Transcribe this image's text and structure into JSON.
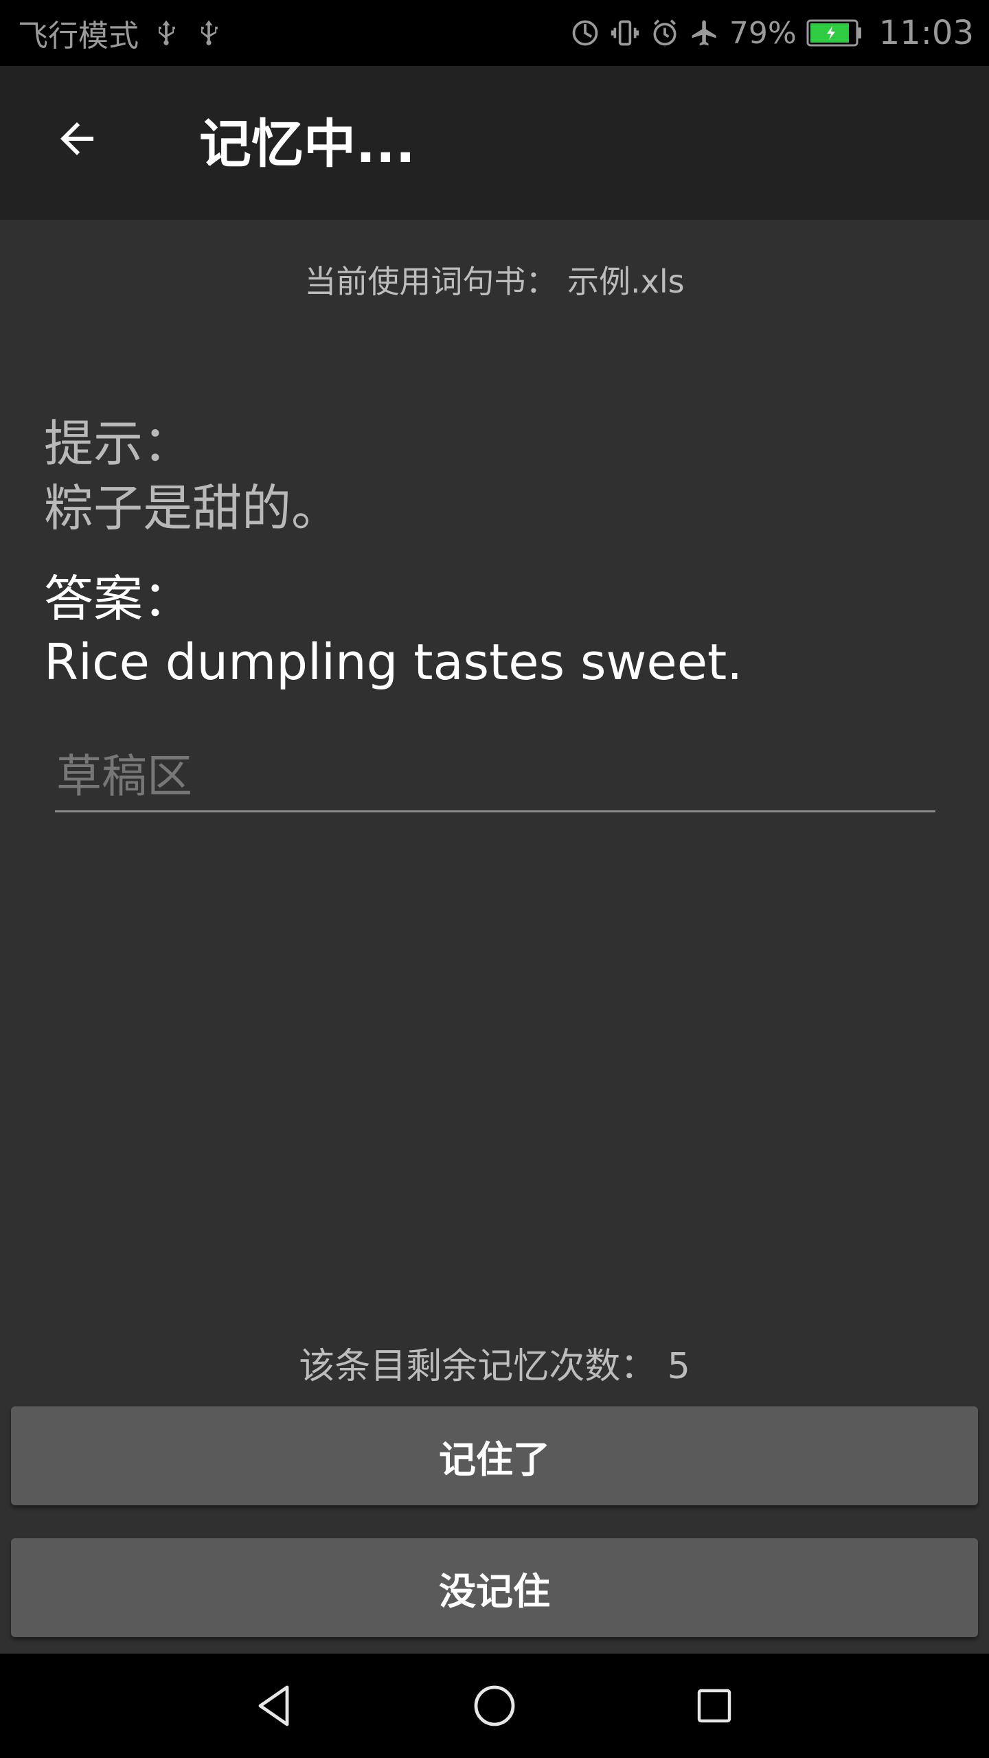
{
  "status_bar": {
    "mode_text": "飞行模式",
    "battery_percent": "79%",
    "time": "11:03",
    "icons": [
      "usb-icon",
      "usb-icon",
      "data-saver-icon",
      "vibrate-icon",
      "alarm-icon",
      "airplane-icon",
      "battery-charging-icon"
    ],
    "battery_color": "#2ecc40"
  },
  "app_bar": {
    "title": "记忆中...",
    "back_icon": "arrow-back-icon"
  },
  "main": {
    "book_line": "当前使用词句书： 示例.xls",
    "hint_label": "提示：",
    "hint_text": "粽子是甜的。",
    "answer_label": "答案：",
    "answer_text": "Rice dumpling tastes sweet.",
    "draft_placeholder": "草稿区",
    "draft_value": "",
    "remaining_line": "该条目剩余记忆次数： 5"
  },
  "buttons": {
    "remembered": "记住了",
    "forgot": "没记住"
  },
  "nav": {
    "icons": [
      "nav-back-icon",
      "nav-home-icon",
      "nav-recent-icon"
    ]
  },
  "colors": {
    "app_bar": "#222222",
    "content_bg": "#303030",
    "button_bg": "#5a5a5a"
  }
}
